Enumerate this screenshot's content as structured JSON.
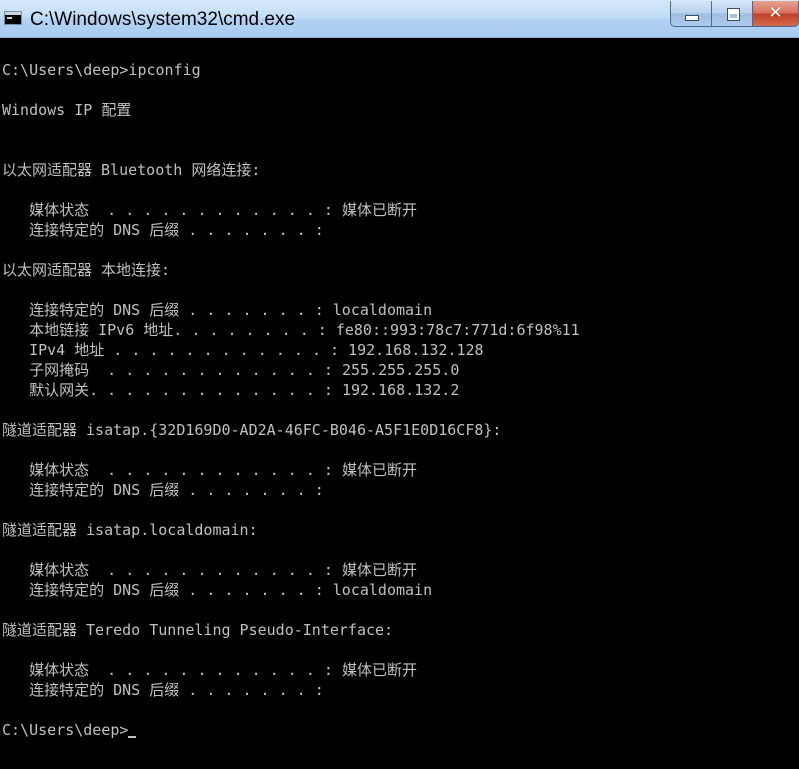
{
  "window": {
    "title": "C:\\Windows\\system32\\cmd.exe",
    "icon": "console-icon",
    "controls": {
      "minimize_icon": "minimize-icon",
      "maximize_icon": "maximize-icon",
      "close_glyph": "✕"
    }
  },
  "console": {
    "background": "#000000",
    "foreground": "#c0c0c0",
    "lines": [
      "",
      "C:\\Users\\deep>ipconfig",
      "",
      "Windows IP 配置",
      "",
      "",
      "以太网适配器 Bluetooth 网络连接:",
      "",
      "   媒体状态  . . . . . . . . . . . . : 媒体已断开",
      "   连接特定的 DNS 后缀 . . . . . . . :",
      "",
      "以太网适配器 本地连接:",
      "",
      "   连接特定的 DNS 后缀 . . . . . . . : localdomain",
      "   本地链接 IPv6 地址. . . . . . . . : fe80::993:78c7:771d:6f98%11",
      "   IPv4 地址 . . . . . . . . . . . . : 192.168.132.128",
      "   子网掩码  . . . . . . . . . . . . : 255.255.255.0",
      "   默认网关. . . . . . . . . . . . . : 192.168.132.2",
      "",
      "隧道适配器 isatap.{32D169D0-AD2A-46FC-B046-A5F1E0D16CF8}:",
      "",
      "   媒体状态  . . . . . . . . . . . . : 媒体已断开",
      "   连接特定的 DNS 后缀 . . . . . . . :",
      "",
      "隧道适配器 isatap.localdomain:",
      "",
      "   媒体状态  . . . . . . . . . . . . : 媒体已断开",
      "   连接特定的 DNS 后缀 . . . . . . . : localdomain",
      "",
      "隧道适配器 Teredo Tunneling Pseudo-Interface:",
      "",
      "   媒体状态  . . . . . . . . . . . . : 媒体已断开",
      "   连接特定的 DNS 后缀 . . . . . . . :",
      "",
      "C:\\Users\\deep>"
    ]
  }
}
